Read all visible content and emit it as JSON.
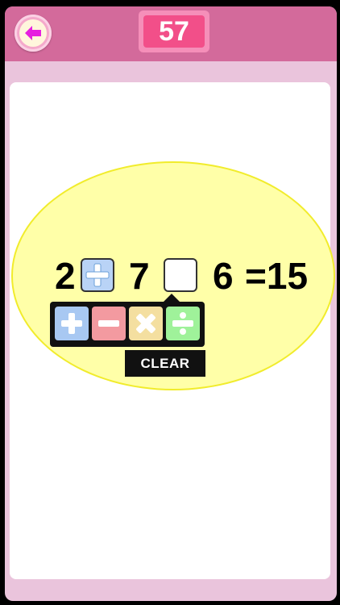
{
  "score": "57",
  "equation": {
    "n1": "2",
    "op1": "plus",
    "n2": "7",
    "op2": "",
    "n3": "6",
    "result": "=15"
  },
  "operators": [
    {
      "name": "plus",
      "color": "#a8c8f2"
    },
    {
      "name": "minus",
      "color": "#f39aa0"
    },
    {
      "name": "multiply",
      "color": "#f4dfa0"
    },
    {
      "name": "divide",
      "color": "#9ff29a"
    }
  ],
  "clear_label": "CLEAR",
  "colors": {
    "topbar": "#d36a9b",
    "frame": "#eac4dc",
    "score_bg": "#f24f89",
    "ellipse": "#ffffa8",
    "back_arrow": "#e61fe0"
  }
}
